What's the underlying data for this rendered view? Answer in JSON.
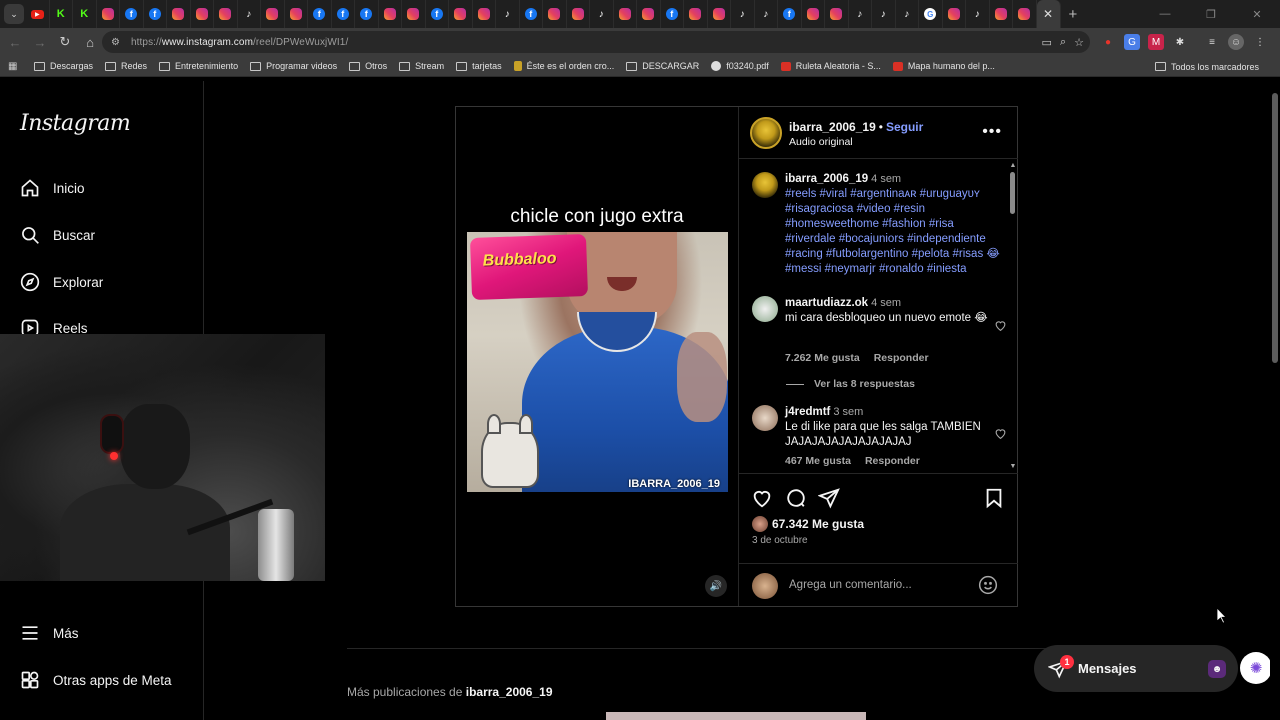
{
  "browser": {
    "tabs": [
      "yt",
      "kk",
      "kk",
      "ig",
      "fb",
      "fb",
      "ig",
      "ig",
      "ig",
      "tt",
      "ig",
      "ig",
      "fb",
      "fb",
      "fb",
      "ig",
      "ig",
      "fb",
      "ig",
      "ig",
      "tt",
      "fb",
      "ig",
      "ig",
      "tt",
      "ig",
      "ig",
      "fb",
      "ig",
      "ig",
      "tt",
      "tt",
      "fb",
      "ig",
      "ig",
      "tt",
      "tt",
      "tt",
      "gg",
      "ig",
      "tt",
      "ig",
      "ig"
    ],
    "active_tab_close": "✕",
    "new_tab": "+",
    "url_prefix": "https://",
    "url_host": "www.instagram.com",
    "url_path": "/reel/DPWeWuxjWI1/",
    "bookmarks": [
      {
        "label": "Descargas",
        "icon": "folder-icon"
      },
      {
        "label": "Redes",
        "icon": "folder-icon"
      },
      {
        "label": "Entretenimiento",
        "icon": "folder-icon"
      },
      {
        "label": "Programar videos",
        "icon": "folder-icon"
      },
      {
        "label": "Otros",
        "icon": "folder-icon"
      },
      {
        "label": "Stream",
        "icon": "folder-icon"
      },
      {
        "label": "tarjetas",
        "icon": "folder-icon"
      },
      {
        "label": "Éste es el orden cro...",
        "icon": "pin-icon"
      },
      {
        "label": "DESCARGAR",
        "icon": "folder-icon"
      },
      {
        "label": "f03240.pdf",
        "icon": "globe-icon"
      },
      {
        "label": "Ruleta Aleatoria - S...",
        "icon": "wheel-icon"
      },
      {
        "label": "Mapa humano del p...",
        "icon": "gmail-icon"
      }
    ],
    "all_bookmarks": "Todos los marcadores"
  },
  "sidebar": {
    "logo": "Instagram",
    "items": [
      {
        "label": "Inicio",
        "icon": "home-icon"
      },
      {
        "label": "Buscar",
        "icon": "search-icon"
      },
      {
        "label": "Explorar",
        "icon": "compass-icon"
      },
      {
        "label": "Reels",
        "icon": "reels-icon"
      },
      {
        "label": "Más",
        "icon": "menu-icon"
      },
      {
        "label": "Otras apps de Meta",
        "icon": "apps-icon"
      }
    ]
  },
  "reel": {
    "title": "chicle con jugo extra",
    "sticker": "Bubbaloo",
    "watermark": "IBARRA_2006_19"
  },
  "post": {
    "username": "ibarra_2006_19",
    "follow": "Seguir",
    "audio": "Audio original",
    "caption_time": "4 sem",
    "hashtags": "#reels #viral #argentinaᴀʀ #uruguayᴜʏ #risagraciosa #video #resin #homesweethome #fashion #risa #riverdale #bocajuniors #independiente #racing #futbolargentino #pelota #risas 😂 #messi #neymarjr #ronaldo #iniesta",
    "comments": [
      {
        "user": "maartudiazz.ok",
        "time": "4 sem",
        "text": "mi cara desbloqueo un nuevo emote 😂",
        "likes": "7.262 Me gusta",
        "reply": "Responder"
      },
      {
        "user": "j4redmtf",
        "time": "3 sem",
        "text": "Le di like para que les salga TAMBIEN JAJAJAJAJAJAJAJAJAJ",
        "likes": "467 Me gusta",
        "reply": "Responder"
      }
    ],
    "view_replies": "Ver las 8 respuestas",
    "likes_total": "67.342 Me gusta",
    "date": "3 de octubre",
    "comment_placeholder": "Agrega un comentario..."
  },
  "more_posts": {
    "prefix": "Más publicaciones de",
    "user": "ibarra_2006_19"
  },
  "messages": {
    "label": "Mensajes",
    "badge": "1"
  },
  "colors": {
    "link": "#859dff",
    "background": "#000000",
    "badge": "#ff3040"
  }
}
